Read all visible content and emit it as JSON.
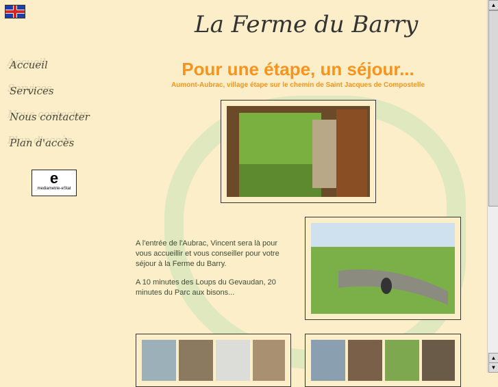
{
  "header": {
    "title": "La Ferme du Barry",
    "language_flag": "uk-flag-icon"
  },
  "nav": [
    {
      "label": "Accueil"
    },
    {
      "label": "Services"
    },
    {
      "label": "Nous contacter"
    },
    {
      "label": "Plan d'accès"
    }
  ],
  "badge": {
    "label": "mediametrie-eStat"
  },
  "main": {
    "heading": "Pour une étape, un séjour...",
    "subheading": "Aumont-Aubrac, village étape sur le chemin de Saint Jacques de Compostelle",
    "paragraphs": [
      "A l'entrée de l'Aubrac, Vincent sera là pour vous accueillir et vous conseiller pour votre séjour à la Ferme du Barry.",
      "A 10 minutes des Loups du Gevaudan, 20 minutes du Parc aux bisons..."
    ]
  },
  "colors": {
    "accent": "#f7941d",
    "background": "#fbeec9"
  }
}
